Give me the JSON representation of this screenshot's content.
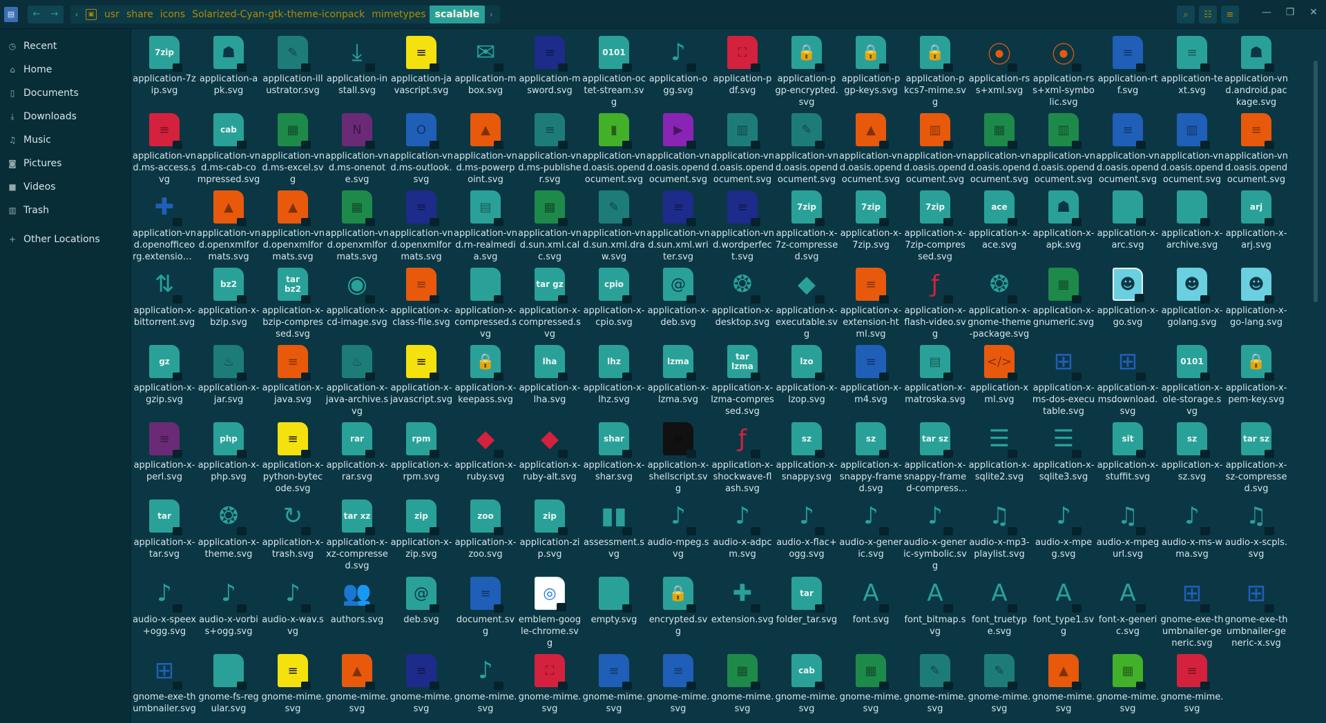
{
  "path": {
    "crumbs": [
      "usr",
      "share",
      "icons",
      "Solarized-Cyan-gtk-theme-iconpack",
      "mimetypes",
      "scalable"
    ]
  },
  "sidebar": {
    "items": [
      {
        "label": "Recent",
        "icon": "clock-icon"
      },
      {
        "label": "Home",
        "icon": "home-icon"
      },
      {
        "label": "Documents",
        "icon": "document-icon"
      },
      {
        "label": "Downloads",
        "icon": "download-icon"
      },
      {
        "label": "Music",
        "icon": "music-icon"
      },
      {
        "label": "Pictures",
        "icon": "camera-icon"
      },
      {
        "label": "Videos",
        "icon": "video-icon"
      },
      {
        "label": "Trash",
        "icon": "trash-icon"
      }
    ],
    "other_locations": "Other Locations"
  },
  "colors": {
    "cyan": "#2aa198",
    "green": "#1e8a4a",
    "yellow": "#f5e10e",
    "orange": "#e8590c",
    "blue": "#1f5fb8",
    "navy": "#1d2b8a",
    "red": "#d4213d",
    "purple": "#8a24b5",
    "teal": "#1e7c78",
    "plum": "#6a2a76",
    "sky": "#6ad0e0",
    "lime": "#43b02a",
    "white": "#ffffff",
    "black": "#111111"
  },
  "files": [
    {
      "label": "application-7zip.svg",
      "color": "cyan",
      "tag": "7zip"
    },
    {
      "label": "application-apk.svg",
      "color": "cyan",
      "glyph": "☗"
    },
    {
      "label": "application-illustrator.svg",
      "color": "teal",
      "glyph": "✎"
    },
    {
      "label": "application-install.svg",
      "color": "cyan",
      "glyph": "⤓"
    },
    {
      "label": "application-javascript.svg",
      "color": "yellow",
      "glyph": "≡"
    },
    {
      "label": "application-mbox.svg",
      "color": "cyan",
      "glyph": "✉"
    },
    {
      "label": "application-msword.svg",
      "color": "navy",
      "glyph": "≡"
    },
    {
      "label": "application-octet-stream.svg",
      "color": "cyan",
      "tag": "0101"
    },
    {
      "label": "application-ogg.svg",
      "color": "cyan",
      "glyph": "♪"
    },
    {
      "label": "application-pdf.svg",
      "color": "red",
      "glyph": "⛶"
    },
    {
      "label": "application-pgp-encrypted.svg",
      "color": "cyan",
      "glyph": "🔒"
    },
    {
      "label": "application-pgp-keys.svg",
      "color": "cyan",
      "glyph": "🔒"
    },
    {
      "label": "application-pkcs7-mime.svg",
      "color": "cyan",
      "glyph": "🔒"
    },
    {
      "label": "application-rss+xml.svg",
      "color": "orange",
      "glyph": "⦿"
    },
    {
      "label": "application-rss+xml-symbolic.svg",
      "color": "orange",
      "glyph": "⦿"
    },
    {
      "label": "application-rtf.svg",
      "color": "blue",
      "glyph": "≡"
    },
    {
      "label": "application-text.svg",
      "color": "cyan",
      "glyph": "≡"
    },
    {
      "label": "application-vnd.android.package.svg",
      "color": "cyan",
      "glyph": "☗"
    },
    {
      "label": "application-vnd.ms-access.svg",
      "color": "red",
      "glyph": "≡"
    },
    {
      "label": "application-vnd.ms-cab-compressed.svg",
      "color": "cyan",
      "tag": "cab"
    },
    {
      "label": "application-vnd.ms-excel.svg",
      "color": "green",
      "glyph": "▦"
    },
    {
      "label": "application-vnd.ms-onenote.svg",
      "color": "plum",
      "glyph": "N"
    },
    {
      "label": "application-vnd.ms-outlook.svg",
      "color": "blue",
      "glyph": "O"
    },
    {
      "label": "application-vnd.ms-powerpoint.svg",
      "color": "orange",
      "glyph": "▲"
    },
    {
      "label": "application-vnd.ms-publisher.svg",
      "color": "teal",
      "glyph": "≡"
    },
    {
      "label": "application-vnd.oasis.opendocument.svg",
      "color": "lime",
      "glyph": "▮"
    },
    {
      "label": "application-vnd.oasis.opendocument.svg",
      "color": "purple",
      "glyph": "▶"
    },
    {
      "label": "application-vnd.oasis.opendocument.svg",
      "color": "teal",
      "glyph": "▥"
    },
    {
      "label": "application-vnd.oasis.opendocument.svg",
      "color": "teal",
      "glyph": "✎"
    },
    {
      "label": "application-vnd.oasis.opendocument.svg",
      "color": "orange",
      "glyph": "▲"
    },
    {
      "label": "application-vnd.oasis.opendocument.svg",
      "color": "orange",
      "glyph": "▥"
    },
    {
      "label": "application-vnd.oasis.opendocument.svg",
      "color": "green",
      "glyph": "▦"
    },
    {
      "label": "application-vnd.oasis.opendocument.svg",
      "color": "green",
      "glyph": "▥"
    },
    {
      "label": "application-vnd.oasis.opendocument.svg",
      "color": "blue",
      "glyph": "≡"
    },
    {
      "label": "application-vnd.oasis.opendocument.svg",
      "color": "blue",
      "glyph": "▥"
    },
    {
      "label": "application-vnd.oasis.opendocument.svg",
      "color": "orange",
      "glyph": "≡"
    },
    {
      "label": "application-vnd.openofficeorg.extension.svg",
      "color": "blue",
      "glyph": "✚"
    },
    {
      "label": "application-vnd.openxmlformats.svg",
      "color": "orange",
      "glyph": "▲"
    },
    {
      "label": "application-vnd.openxmlformats.svg",
      "color": "orange",
      "glyph": "▲"
    },
    {
      "label": "application-vnd.openxmlformats.svg",
      "color": "green",
      "glyph": "▦"
    },
    {
      "label": "application-vnd.openxmlformats.svg",
      "color": "navy",
      "glyph": "≡"
    },
    {
      "label": "application-vnd.rn-realmedia.svg",
      "color": "cyan",
      "glyph": "▤"
    },
    {
      "label": "application-vnd.sun.xml.calc.svg",
      "color": "green",
      "glyph": "▦"
    },
    {
      "label": "application-vnd.sun.xml.draw.svg",
      "color": "teal",
      "glyph": "✎"
    },
    {
      "label": "application-vnd.sun.xml.writer.svg",
      "color": "navy",
      "glyph": "≡"
    },
    {
      "label": "application-vnd.wordperfect.svg",
      "color": "navy",
      "glyph": "≡"
    },
    {
      "label": "application-x-7z-compressed.svg",
      "color": "cyan",
      "tag": "7zip"
    },
    {
      "label": "application-x-7zip.svg",
      "color": "cyan",
      "tag": "7zip"
    },
    {
      "label": "application-x-7zip-compressed.svg",
      "color": "cyan",
      "tag": "7zip"
    },
    {
      "label": "application-x-ace.svg",
      "color": "cyan",
      "tag": "ace"
    },
    {
      "label": "application-x-apk.svg",
      "color": "cyan",
      "glyph": "☗"
    },
    {
      "label": "application-x-arc.svg",
      "color": "cyan",
      "glyph": " "
    },
    {
      "label": "application-x-archive.svg",
      "color": "cyan",
      "glyph": " "
    },
    {
      "label": "application-x-arj.svg",
      "color": "cyan",
      "tag": "arj"
    },
    {
      "label": "application-x-bittorrent.svg",
      "color": "cyan",
      "glyph": "⇅"
    },
    {
      "label": "application-x-bzip.svg",
      "color": "cyan",
      "tag": "bz2"
    },
    {
      "label": "application-x-bzip-compressed.svg",
      "color": "cyan",
      "tag": "tar bz2"
    },
    {
      "label": "application-x-cd-image.svg",
      "color": "cyan",
      "glyph": "◉"
    },
    {
      "label": "application-x-class-file.svg",
      "color": "orange",
      "glyph": "≡"
    },
    {
      "label": "application-x-compressed.svg",
      "color": "cyan",
      "glyph": " "
    },
    {
      "label": "application-x-compressed.svg",
      "color": "cyan",
      "tag": "tar gz"
    },
    {
      "label": "application-x-cpio.svg",
      "color": "cyan",
      "tag": "cpio"
    },
    {
      "label": "application-x-deb.svg",
      "color": "cyan",
      "glyph": "@"
    },
    {
      "label": "application-x-desktop.svg",
      "color": "cyan",
      "glyph": "❂"
    },
    {
      "label": "application-x-executable.svg",
      "color": "cyan",
      "glyph": "◆"
    },
    {
      "label": "application-x-extension-html.svg",
      "color": "orange",
      "glyph": "≡"
    },
    {
      "label": "application-x-flash-video.svg",
      "color": "red",
      "glyph": "ƒ"
    },
    {
      "label": "application-x-gnome-theme-package.svg",
      "color": "cyan",
      "glyph": "❂"
    },
    {
      "label": "application-x-gnumeric.svg",
      "color": "green",
      "glyph": "▦"
    },
    {
      "label": "application-x-go.svg",
      "color": "sky",
      "glyph": "☻",
      "frame": true
    },
    {
      "label": "application-x-golang.svg",
      "color": "sky",
      "glyph": "☻"
    },
    {
      "label": "application-x-go-lang.svg",
      "color": "sky",
      "glyph": "☻"
    },
    {
      "label": "application-x-gzip.svg",
      "color": "cyan",
      "tag": "gz"
    },
    {
      "label": "application-x-jar.svg",
      "color": "teal",
      "glyph": "♨"
    },
    {
      "label": "application-x-java.svg",
      "color": "orange",
      "glyph": "≡"
    },
    {
      "label": "application-x-java-archive.svg",
      "color": "teal",
      "glyph": "♨"
    },
    {
      "label": "application-x-javascript.svg",
      "color": "yellow",
      "glyph": "≡"
    },
    {
      "label": "application-x-keepass.svg",
      "color": "cyan",
      "glyph": "🔒"
    },
    {
      "label": "application-x-lha.svg",
      "color": "cyan",
      "tag": "lha"
    },
    {
      "label": "application-x-lhz.svg",
      "color": "cyan",
      "tag": "lhz"
    },
    {
      "label": "application-x-lzma.svg",
      "color": "cyan",
      "tag": "lzma"
    },
    {
      "label": "application-x-lzma-compressed.svg",
      "color": "cyan",
      "tag": "tar lzma"
    },
    {
      "label": "application-x-lzop.svg",
      "color": "cyan",
      "tag": "lzo"
    },
    {
      "label": "application-x-m4.svg",
      "color": "blue",
      "glyph": "≡"
    },
    {
      "label": "application-x-matroska.svg",
      "color": "cyan",
      "glyph": "▤"
    },
    {
      "label": "application-xml.svg",
      "color": "orange",
      "glyph": "</>"
    },
    {
      "label": "application-x-ms-dos-executable.svg",
      "color": "blue",
      "glyph": "⊞"
    },
    {
      "label": "application-x-msdownload.svg",
      "color": "blue",
      "glyph": "⊞"
    },
    {
      "label": "application-x-ole-storage.svg",
      "color": "cyan",
      "tag": "0101"
    },
    {
      "label": "application-x-pem-key.svg",
      "color": "cyan",
      "glyph": "🔒"
    },
    {
      "label": "application-x-perl.svg",
      "color": "plum",
      "glyph": "≡"
    },
    {
      "label": "application-x-php.svg",
      "color": "cyan",
      "tag": "php"
    },
    {
      "label": "application-x-python-bytecode.svg",
      "color": "yellow",
      "glyph": "≡"
    },
    {
      "label": "application-x-rar.svg",
      "color": "cyan",
      "tag": "rar"
    },
    {
      "label": "application-x-rpm.svg",
      "color": "cyan",
      "tag": "rpm"
    },
    {
      "label": "application-x-ruby.svg",
      "color": "red",
      "glyph": "◆"
    },
    {
      "label": "application-x-ruby-alt.svg",
      "color": "red",
      "glyph": "◆"
    },
    {
      "label": "application-x-shar.svg",
      "color": "cyan",
      "tag": "shar"
    },
    {
      "label": "application-x-shellscript.svg",
      "color": "black",
      "glyph": "≡"
    },
    {
      "label": "application-x-shockwave-flash.svg",
      "color": "red",
      "glyph": "ƒ"
    },
    {
      "label": "application-x-snappy.svg",
      "color": "cyan",
      "tag": "sz"
    },
    {
      "label": "application-x-snappy-framed.svg",
      "color": "cyan",
      "tag": "sz"
    },
    {
      "label": "application-x-snappy-framed-compressed.svg",
      "color": "cyan",
      "tag": "tar sz"
    },
    {
      "label": "application-x-sqlite2.svg",
      "color": "cyan",
      "glyph": "☰"
    },
    {
      "label": "application-x-sqlite3.svg",
      "color": "cyan",
      "glyph": "☰"
    },
    {
      "label": "application-x-stuffit.svg",
      "color": "cyan",
      "tag": "sit"
    },
    {
      "label": "application-x-sz.svg",
      "color": "cyan",
      "tag": "sz"
    },
    {
      "label": "application-x-sz-compressed.svg",
      "color": "cyan",
      "tag": "tar sz"
    },
    {
      "label": "application-x-tar.svg",
      "color": "cyan",
      "tag": "tar"
    },
    {
      "label": "application-x-theme.svg",
      "color": "cyan",
      "glyph": "❂"
    },
    {
      "label": "application-x-trash.svg",
      "color": "cyan",
      "glyph": "↻"
    },
    {
      "label": "application-x-xz-compressed.svg",
      "color": "cyan",
      "tag": "tar xz"
    },
    {
      "label": "application-x-zip.svg",
      "color": "cyan",
      "tag": "zip"
    },
    {
      "label": "application-x-zoo.svg",
      "color": "cyan",
      "tag": "zoo"
    },
    {
      "label": "application-zip.svg",
      "color": "cyan",
      "tag": "zip"
    },
    {
      "label": "assessment.svg",
      "color": "cyan",
      "glyph": "▮▮"
    },
    {
      "label": "audio-mpeg.svg",
      "color": "cyan",
      "glyph": "♪"
    },
    {
      "label": "audio-x-adpcm.svg",
      "color": "cyan",
      "glyph": "♪"
    },
    {
      "label": "audio-x-flac+ogg.svg",
      "color": "cyan",
      "glyph": "♪"
    },
    {
      "label": "audio-x-generic.svg",
      "color": "cyan",
      "glyph": "♪"
    },
    {
      "label": "audio-x-generic-symbolic.svg",
      "color": "cyan",
      "glyph": "♪"
    },
    {
      "label": "audio-x-mp3-playlist.svg",
      "color": "cyan",
      "glyph": "♫"
    },
    {
      "label": "audio-x-mpeg.svg",
      "color": "cyan",
      "glyph": "♪"
    },
    {
      "label": "audio-x-mpegurl.svg",
      "color": "cyan",
      "glyph": "♫"
    },
    {
      "label": "audio-x-ms-wma.svg",
      "color": "cyan",
      "glyph": "♪"
    },
    {
      "label": "audio-x-scpls.svg",
      "color": "cyan",
      "glyph": "♫"
    },
    {
      "label": "audio-x-speex+ogg.svg",
      "color": "cyan",
      "glyph": "♪"
    },
    {
      "label": "audio-x-vorbis+ogg.svg",
      "color": "cyan",
      "glyph": "♪"
    },
    {
      "label": "audio-x-wav.svg",
      "color": "cyan",
      "glyph": "♪"
    },
    {
      "label": "authors.svg",
      "color": "cyan",
      "glyph": "👥"
    },
    {
      "label": "deb.svg",
      "color": "cyan",
      "glyph": "@"
    },
    {
      "label": "document.svg",
      "color": "blue",
      "glyph": "≡"
    },
    {
      "label": "emblem-google-chrome.svg",
      "color": "white",
      "glyph": "◎",
      "frame": true
    },
    {
      "label": "empty.svg",
      "color": "cyan",
      "glyph": " "
    },
    {
      "label": "encrypted.svg",
      "color": "cyan",
      "glyph": "🔒"
    },
    {
      "label": "extension.svg",
      "color": "cyan",
      "glyph": "✚"
    },
    {
      "label": "folder_tar.svg",
      "color": "cyan",
      "tag": "tar"
    },
    {
      "label": "font.svg",
      "color": "cyan",
      "glyph": "A"
    },
    {
      "label": "font_bitmap.svg",
      "color": "cyan",
      "glyph": "A"
    },
    {
      "label": "font_truetype.svg",
      "color": "cyan",
      "glyph": "A"
    },
    {
      "label": "font_type1.svg",
      "color": "cyan",
      "glyph": "A"
    },
    {
      "label": "font-x-generic.svg",
      "color": "cyan",
      "glyph": "A"
    },
    {
      "label": "gnome-exe-thumbnailer-generic.svg",
      "color": "blue",
      "glyph": "⊞"
    },
    {
      "label": "gnome-exe-thumbnailer-generic-x.svg",
      "color": "blue",
      "glyph": "⊞"
    },
    {
      "label": "gnome-exe-thumbnailer.svg",
      "color": "blue",
      "glyph": "⊞"
    },
    {
      "label": "gnome-fs-regular.svg",
      "color": "cyan",
      "glyph": " "
    },
    {
      "label": "gnome-mime.svg",
      "color": "yellow",
      "glyph": "≡"
    },
    {
      "label": "gnome-mime.svg",
      "color": "orange",
      "glyph": "▲"
    },
    {
      "label": "gnome-mime.svg",
      "color": "navy",
      "glyph": "≡"
    },
    {
      "label": "gnome-mime.svg",
      "color": "cyan",
      "glyph": "♪"
    },
    {
      "label": "gnome-mime.svg",
      "color": "red",
      "glyph": "⛶"
    },
    {
      "label": "gnome-mime.svg",
      "color": "blue",
      "glyph": "≡"
    },
    {
      "label": "gnome-mime.svg",
      "color": "blue",
      "glyph": "≡"
    },
    {
      "label": "gnome-mime.svg",
      "color": "green",
      "glyph": "▦"
    },
    {
      "label": "gnome-mime.svg",
      "color": "cyan",
      "tag": "cab"
    },
    {
      "label": "gnome-mime.svg",
      "color": "green",
      "glyph": "▦"
    },
    {
      "label": "gnome-mime.svg",
      "color": "teal",
      "glyph": "✎"
    },
    {
      "label": "gnome-mime.svg",
      "color": "teal",
      "glyph": "✎"
    },
    {
      "label": "gnome-mime.svg",
      "color": "orange",
      "glyph": "▲"
    },
    {
      "label": "gnome-mime.svg",
      "color": "lime",
      "glyph": "▦"
    },
    {
      "label": "gnome-mime.svg",
      "color": "red",
      "glyph": "≡"
    }
  ]
}
